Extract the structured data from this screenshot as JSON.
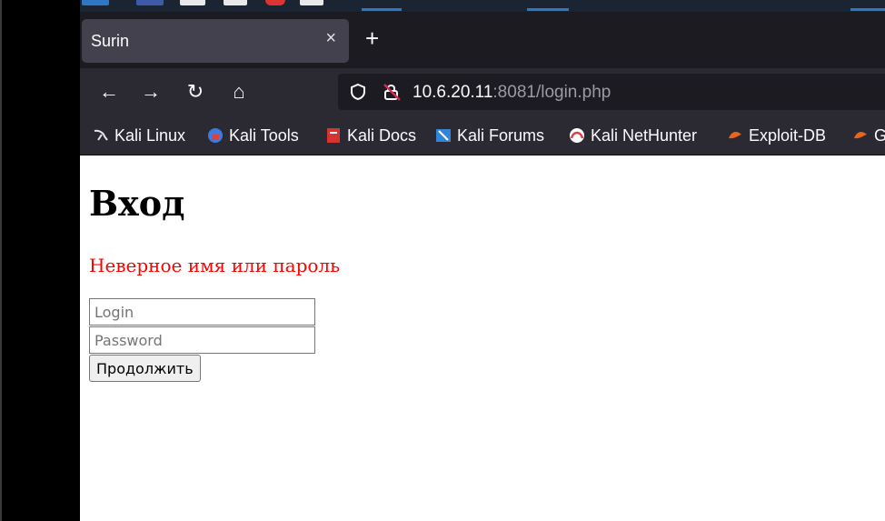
{
  "browser": {
    "tab": {
      "title": "Surin",
      "close_glyph": "×"
    },
    "new_tab_glyph": "+",
    "nav": {
      "back_glyph": "←",
      "forward_glyph": "→",
      "reload_glyph": "↻",
      "home_glyph": "⌂"
    },
    "url": {
      "host": "10.6.20.11",
      "rest": ":8081/login.php"
    },
    "bookmarks": [
      {
        "label": "Kali Linux",
        "icon": "kali-dragon-icon",
        "color": "#e6e6e6"
      },
      {
        "label": "Kali Tools",
        "icon": "kali-tools-icon",
        "color": "#3d7be0"
      },
      {
        "label": "Kali Docs",
        "icon": "kali-docs-icon",
        "color": "#d63333"
      },
      {
        "label": "Kali Forums",
        "icon": "kali-forums-icon",
        "color": "#2f86d8"
      },
      {
        "label": "Kali NetHunter",
        "icon": "nethunter-icon",
        "color": "#e04040"
      },
      {
        "label": "Exploit-DB",
        "icon": "exploit-db-icon",
        "color": "#e8651a"
      },
      {
        "label": "G",
        "icon": "ghdb-icon",
        "color": "#e8651a"
      }
    ]
  },
  "page": {
    "heading": "Вход",
    "error": "Неверное имя или пароль",
    "login_placeholder": "Login",
    "password_placeholder": "Password",
    "submit_label": "Продолжить",
    "error_color": "#ff0000"
  }
}
